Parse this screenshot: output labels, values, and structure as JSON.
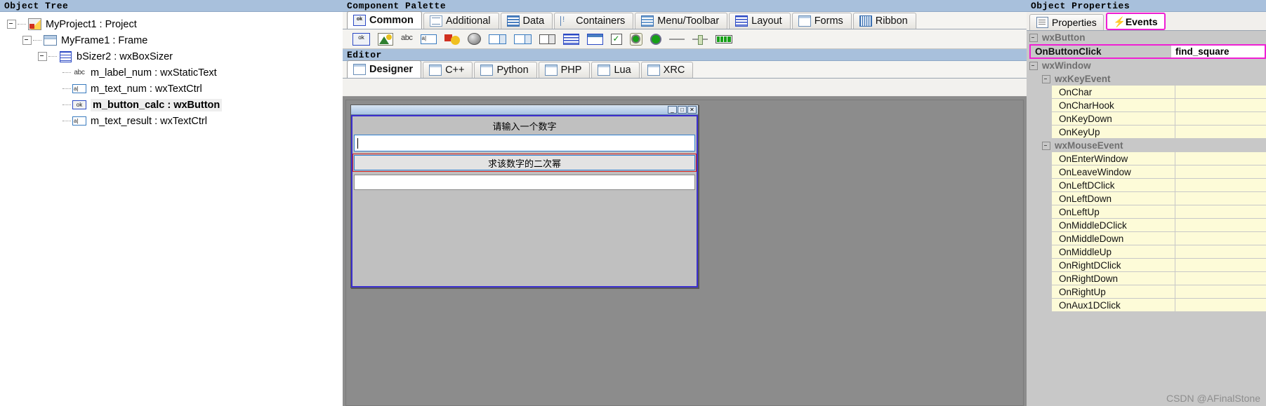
{
  "panels": {
    "tree_caption": "Object Tree",
    "palette_caption": "Component Palette",
    "editor_caption": "Editor",
    "properties_caption": "Object Properties"
  },
  "tree": {
    "items": [
      {
        "label": "MyProject1 : Project",
        "icon": "project-icon",
        "depth": 0,
        "expander": true,
        "selected": false
      },
      {
        "label": "MyFrame1 : Frame",
        "icon": "frame-icon",
        "depth": 1,
        "expander": true,
        "selected": false
      },
      {
        "label": "bSizer2 : wxBoxSizer",
        "icon": "boxsizer-icon",
        "depth": 2,
        "expander": true,
        "selected": false
      },
      {
        "label": "m_label_num : wxStaticText",
        "icon": "statictext-icon",
        "depth": 3,
        "expander": false,
        "selected": false,
        "icon_text": "abc"
      },
      {
        "label": "m_text_num : wxTextCtrl",
        "icon": "textctrl-icon",
        "depth": 3,
        "expander": false,
        "selected": false,
        "icon_text": "a|"
      },
      {
        "label": "m_button_calc : wxButton",
        "icon": "button-icon",
        "depth": 3,
        "expander": false,
        "selected": true,
        "icon_text": "ok"
      },
      {
        "label": "m_text_result : wxTextCtrl",
        "icon": "textctrl-icon",
        "depth": 3,
        "expander": false,
        "selected": false,
        "icon_text": "a|"
      }
    ]
  },
  "palette": {
    "tabs": [
      {
        "label": "Common",
        "icon": "ok-button-icon",
        "active": true
      },
      {
        "label": "Additional",
        "icon": "additional-icon",
        "active": false
      },
      {
        "label": "Data",
        "icon": "data-grid-icon",
        "active": false
      },
      {
        "label": "Containers",
        "icon": "containers-icon",
        "active": false
      },
      {
        "label": "Menu/Toolbar",
        "icon": "menu-toolbar-icon",
        "active": false
      },
      {
        "label": "Layout",
        "icon": "layout-icon",
        "active": false
      },
      {
        "label": "Forms",
        "icon": "forms-icon",
        "active": false
      },
      {
        "label": "Ribbon",
        "icon": "ribbon-icon",
        "active": false
      }
    ],
    "tools": [
      "wxbutton-icon",
      "wxbitmapbutton-icon",
      "wxstatictext-icon",
      "wxtextctrl-icon",
      "wxstaticbitmap-icon",
      "wxanimationctrl-icon",
      "wxcombobox-icon",
      "wxcombobox2-icon",
      "wxchoice-icon",
      "wxlistbox-icon",
      "wxlistctrl-icon",
      "wxcheckbox-icon",
      "wxradiobutton-on-icon",
      "wxradiobutton-icon",
      "wxstaticline-icon",
      "wxslider-icon",
      "wxgauge-icon"
    ]
  },
  "editor": {
    "tabs": [
      {
        "label": "Designer",
        "icon": "designer-icon",
        "active": true
      },
      {
        "label": "C++",
        "icon": "cpp-icon",
        "active": false
      },
      {
        "label": "Python",
        "icon": "python-icon",
        "active": false
      },
      {
        "label": "PHP",
        "icon": "php-icon",
        "active": false
      },
      {
        "label": "Lua",
        "icon": "lua-icon",
        "active": false
      },
      {
        "label": "XRC",
        "icon": "xrc-icon",
        "active": false
      }
    ]
  },
  "designed_frame": {
    "window_buttons": [
      {
        "label": "_",
        "name": "minimize-button"
      },
      {
        "label": "□",
        "name": "maximize-button"
      },
      {
        "label": "✕",
        "name": "close-button"
      }
    ],
    "static_text": "请输入一个数字",
    "input_value": "",
    "button_label": "求该数字的二次幂",
    "result_value": ""
  },
  "properties": {
    "tabs": [
      {
        "label": "Properties",
        "icon": "properties-icon",
        "active": false
      },
      {
        "label": "Events",
        "icon": "events-icon",
        "active": true
      }
    ],
    "groups": [
      {
        "name": "wxButton",
        "level": 1,
        "events": [
          {
            "name": "OnButtonClick",
            "value": "find_square",
            "highlight": true
          }
        ]
      },
      {
        "name": "wxWindow",
        "level": 1,
        "events": []
      },
      {
        "name": "wxKeyEvent",
        "level": 2,
        "events": [
          {
            "name": "OnChar",
            "value": ""
          },
          {
            "name": "OnCharHook",
            "value": ""
          },
          {
            "name": "OnKeyDown",
            "value": ""
          },
          {
            "name": "OnKeyUp",
            "value": ""
          }
        ]
      },
      {
        "name": "wxMouseEvent",
        "level": 2,
        "events": [
          {
            "name": "OnEnterWindow",
            "value": ""
          },
          {
            "name": "OnLeaveWindow",
            "value": ""
          },
          {
            "name": "OnLeftDClick",
            "value": ""
          },
          {
            "name": "OnLeftDown",
            "value": ""
          },
          {
            "name": "OnLeftUp",
            "value": ""
          },
          {
            "name": "OnMiddleDClick",
            "value": ""
          },
          {
            "name": "OnMiddleDown",
            "value": ""
          },
          {
            "name": "OnMiddleUp",
            "value": ""
          },
          {
            "name": "OnRightDClick",
            "value": ""
          },
          {
            "name": "OnRightDown",
            "value": ""
          },
          {
            "name": "OnRightUp",
            "value": ""
          },
          {
            "name": "OnAux1DClick",
            "value": ""
          }
        ]
      }
    ]
  },
  "watermark": "CSDN @AFinalStone",
  "colors": {
    "caption_bar": "#a8c0dc",
    "highlight_magenta": "#ef1fd4",
    "event_row_bg": "#fdfbd8",
    "canvas_bg": "#8c8c8c",
    "selection_red": "#d42020",
    "selection_blue": "#3b2fcf"
  }
}
